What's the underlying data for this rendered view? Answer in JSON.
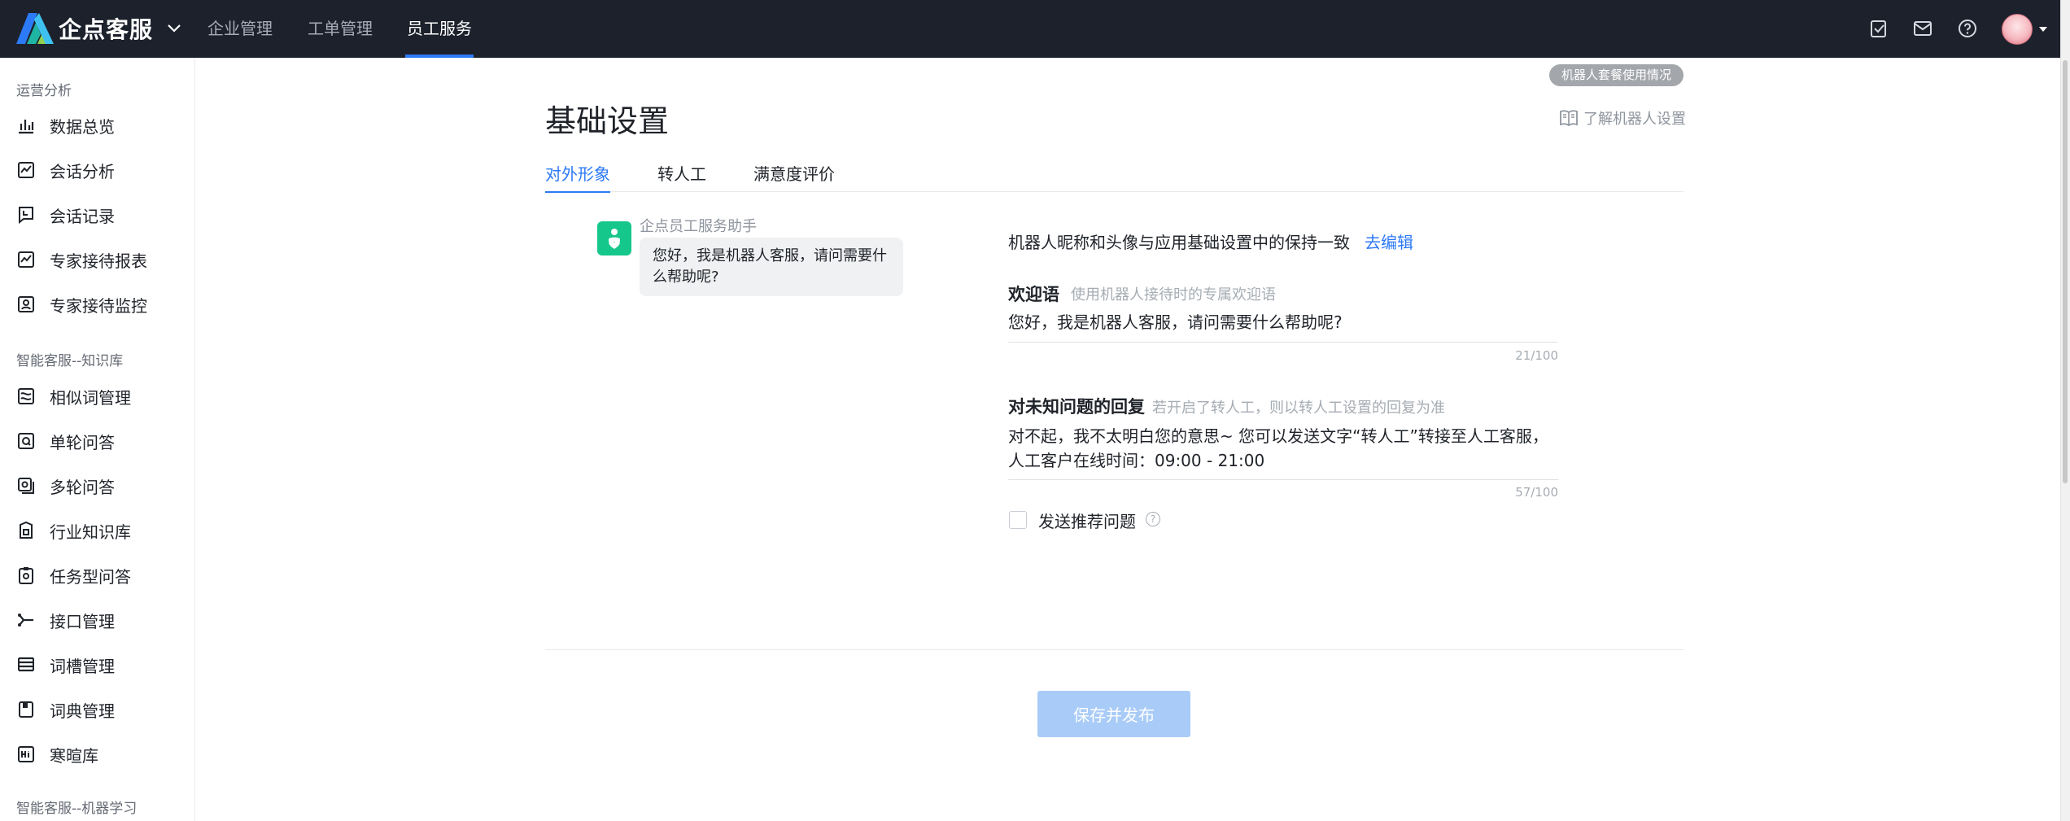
{
  "header": {
    "brand": "企点客服",
    "nav": [
      "企业管理",
      "工单管理",
      "员工服务"
    ],
    "active_nav": "员工服务",
    "icons": [
      "task-check-icon",
      "mail-icon",
      "help-circle-icon"
    ]
  },
  "sidebar": {
    "groups": [
      {
        "title": "运营分析",
        "items": [
          {
            "label": "数据总览",
            "icon": "bar-chart-icon"
          },
          {
            "label": "会话分析",
            "icon": "line-chart-icon"
          },
          {
            "label": "会话记录",
            "icon": "chat-record-icon"
          },
          {
            "label": "专家接待报表",
            "icon": "report-chart-icon"
          },
          {
            "label": "专家接待监控",
            "icon": "monitor-user-icon"
          }
        ]
      },
      {
        "title": "智能客服--知识库",
        "items": [
          {
            "label": "相似词管理",
            "icon": "similar-words-icon"
          },
          {
            "label": "单轮问答",
            "icon": "single-qa-icon"
          },
          {
            "label": "多轮问答",
            "icon": "multi-qa-icon"
          },
          {
            "label": "行业知识库",
            "icon": "industry-knowledge-icon"
          },
          {
            "label": "任务型问答",
            "icon": "task-qa-icon"
          },
          {
            "label": "接口管理",
            "icon": "api-branch-icon"
          },
          {
            "label": "词槽管理",
            "icon": "slot-list-icon"
          },
          {
            "label": "词典管理",
            "icon": "dictionary-book-icon"
          },
          {
            "label": "寒暄库",
            "icon": "greeting-library-icon"
          }
        ]
      },
      {
        "title": "智能客服--机器学习",
        "items": []
      }
    ]
  },
  "main": {
    "usage_badge": "机器人套餐使用情况",
    "title": "基础设置",
    "help_link": "了解机器人设置",
    "tabs": [
      "对外形象",
      "转人工",
      "满意度评价"
    ],
    "active_tab": "对外形象",
    "preview": {
      "bot_name": "企点员工服务助手",
      "message": "您好，我是机器人客服，请问需要什么帮助呢?"
    },
    "sync_text": "机器人昵称和头像与应用基础设置中的保持一致",
    "sync_edit": "去编辑",
    "welcome": {
      "label": "欢迎语",
      "hint": "使用机器人接待时的专属欢迎语",
      "value": "您好，我是机器人客服，请问需要什么帮助呢?",
      "count": "21/100"
    },
    "unknown": {
      "label": "对未知问题的回复",
      "hint": "若开启了转人工，则以转人工设置的回复为准",
      "value": "对不起，我不太明白您的意思~ 您可以发送文字“转人工”转接至人工客服，人工客户在线时间：09:00 - 21:00",
      "count": "57/100"
    },
    "send_recommend": {
      "label": "发送推荐问题",
      "checked": false
    },
    "save_button": "保存并发布"
  },
  "colors": {
    "accent": "#2d7af6",
    "topbar": "#1c212c",
    "bot_avatar": "#16c78c",
    "save_disabled": "#a9cbf7"
  }
}
